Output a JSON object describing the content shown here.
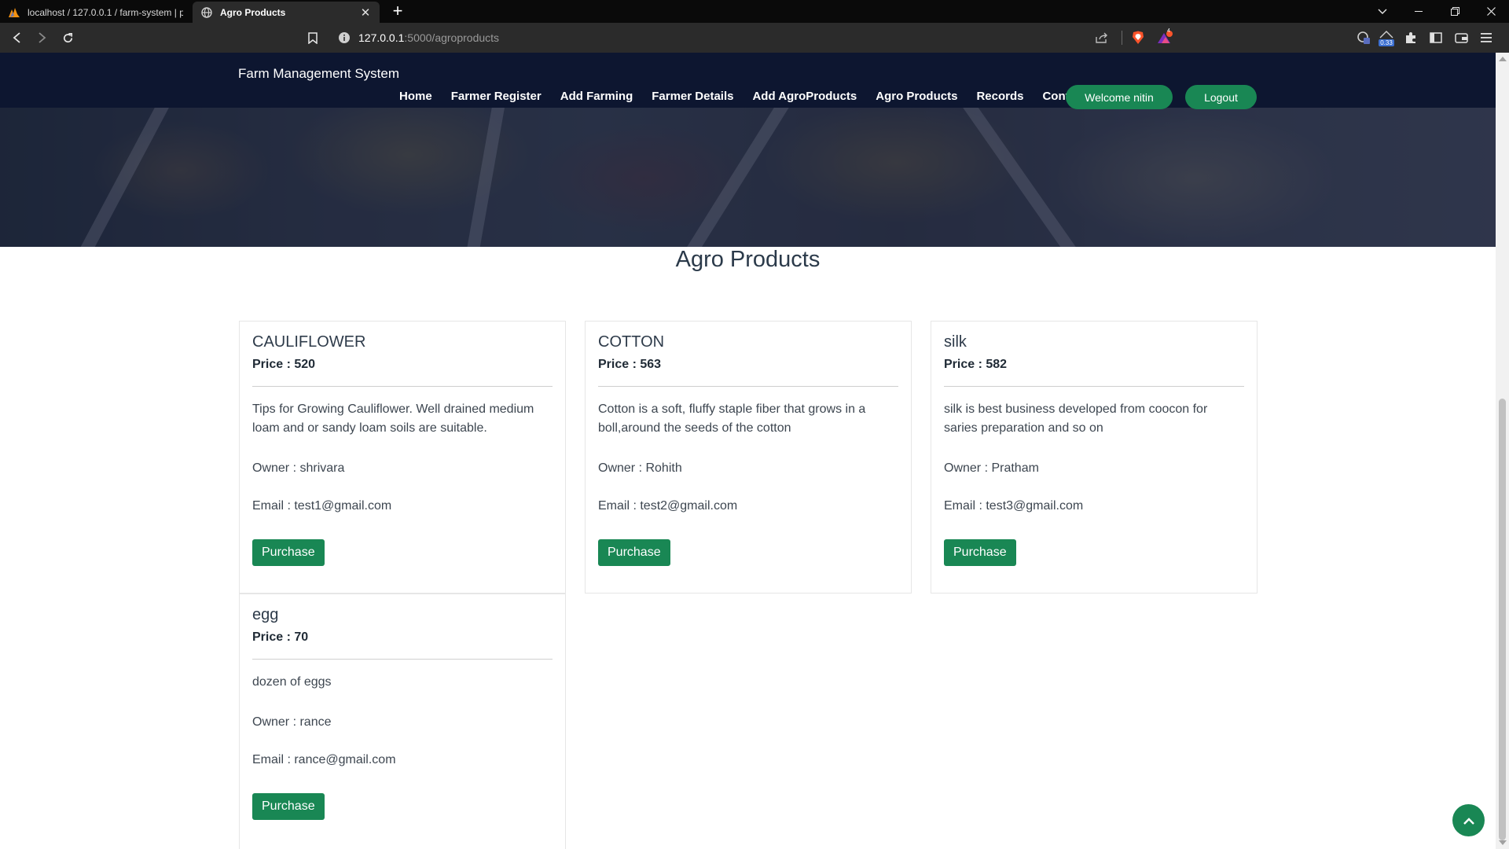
{
  "browser": {
    "tabs": [
      {
        "title": "localhost / 127.0.0.1 / farm-system | p",
        "active": false
      },
      {
        "title": "Agro Products",
        "active": true
      }
    ],
    "url_host": "127.0.0.1",
    "url_path": ":5000/agroproducts",
    "shield_count": "",
    "badge_count": "4",
    "stats_label": "0.33"
  },
  "site": {
    "brand": "Farm Management System",
    "nav": [
      "Home",
      "Farmer Register",
      "Add Farming",
      "Farmer Details",
      "Add AgroProducts",
      "Agro Products",
      "Records",
      "Contact"
    ],
    "welcome": "Welcome nitin",
    "logout": "Logout"
  },
  "page": {
    "title": "Agro Products",
    "purchase_label": "Purchase",
    "products": [
      {
        "name": "CAULIFLOWER",
        "price": "Price : 520",
        "description": "Tips for Growing Cauliflower. Well drained medium loam and or sandy loam soils are suitable.",
        "owner": "Owner : shrivara",
        "email": "Email : test1@gmail.com"
      },
      {
        "name": "COTTON",
        "price": "Price : 563",
        "description": "Cotton is a soft, fluffy staple fiber that grows in a boll,around the seeds of the cotton",
        "owner": "Owner : Rohith",
        "email": "Email : test2@gmail.com"
      },
      {
        "name": "silk",
        "price": "Price : 582",
        "description": "silk is best business developed from coocon for saries preparation and so on",
        "owner": "Owner : Pratham",
        "email": "Email : test3@gmail.com"
      },
      {
        "name": "egg",
        "price": "Price : 70",
        "description": "dozen of eggs",
        "owner": "Owner : rance",
        "email": "Email : rance@gmail.com"
      }
    ]
  },
  "colors": {
    "navbar": "#0d1630",
    "accent_green": "#198754",
    "chrome_dark": "#0a0a0a",
    "toolbar": "#2b2b2b"
  }
}
